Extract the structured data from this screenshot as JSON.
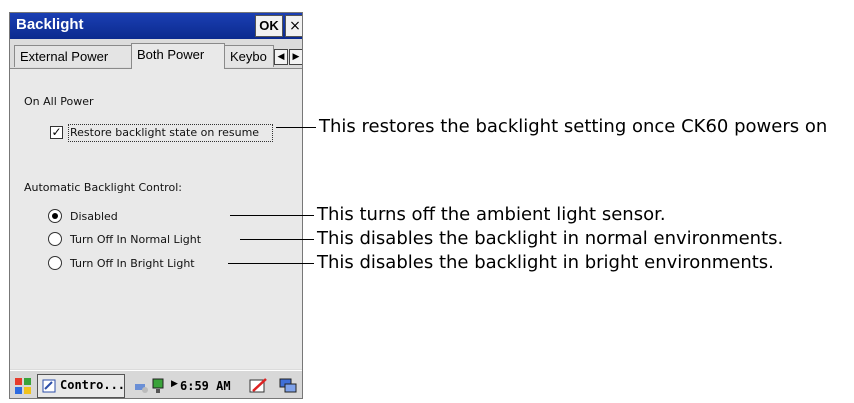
{
  "window": {
    "title": "Backlight",
    "ok_label": "OK",
    "close_label": "×"
  },
  "tabs": [
    {
      "label": "External Power",
      "active": false
    },
    {
      "label": "Both Power",
      "active": true
    },
    {
      "label": "Keybo",
      "active": false
    }
  ],
  "tab_scroll": {
    "left": "◀",
    "right": "▶"
  },
  "panel": {
    "section1_label": "On All Power",
    "restore_checkbox": {
      "label": "Restore backlight state on resume",
      "checked": true,
      "mark": "✓"
    },
    "section2_label": "Automatic Backlight Control:",
    "radios": [
      {
        "label": "Disabled",
        "checked": true
      },
      {
        "label": "Turn Off In Normal Light",
        "checked": false
      },
      {
        "label": "Turn Off In Bright Light",
        "checked": false
      }
    ]
  },
  "taskbar": {
    "start_icon": "windows-flag-icon",
    "task_label": "Contro...",
    "time": "6:59 AM"
  },
  "annotations": [
    "This restores the backlight setting once CK60 powers on",
    "This turns off the ambient light sensor.",
    "This disables the backlight in normal environments.",
    "This disables the backlight in bright environments."
  ]
}
